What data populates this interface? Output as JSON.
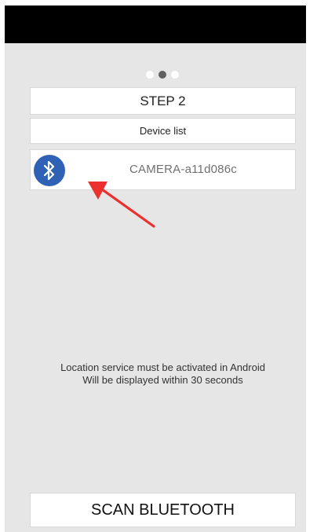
{
  "colors": {
    "status_bar": "#000000",
    "screen_background": "#e7e6e6",
    "card_background": "#ffffff",
    "bluetooth_badge": "#2f62b5",
    "annotation_arrow": "#ec2f2f"
  },
  "pager": {
    "count": 3,
    "active_index": 1
  },
  "step": {
    "title": "STEP 2"
  },
  "device_list": {
    "header": "Device list",
    "items": [
      {
        "icon": "bluetooth-icon",
        "name": "CAMERA-a11d086c"
      }
    ]
  },
  "info": {
    "line1": "Location service must be activated in Android",
    "line2": "Will be displayed within 30 seconds"
  },
  "actions": {
    "scan_label": "SCAN BLUETOOTH"
  },
  "annotation": {
    "icon": "arrow-pointer-icon"
  }
}
